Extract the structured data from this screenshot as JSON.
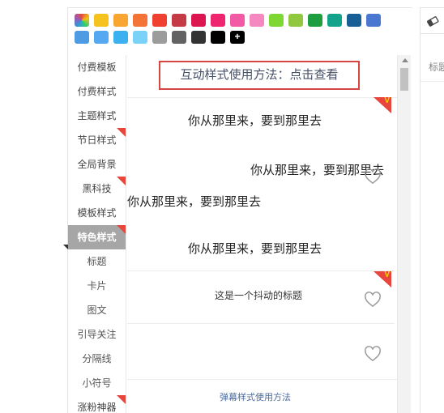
{
  "palette": {
    "row1": [
      {
        "color": "rainbow",
        "icon": "color-picker-icon"
      },
      {
        "color": "#f6c21e"
      },
      {
        "color": "#f8a532"
      },
      {
        "color": "#f37436"
      },
      {
        "color": "#f04130"
      },
      {
        "color": "#c43a45"
      },
      {
        "color": "#dc1550"
      },
      {
        "color": "#f0256f"
      },
      {
        "color": "#f35aa5"
      },
      {
        "color": "#f587c1"
      },
      {
        "color": "#7fd733"
      },
      {
        "color": "#92c840"
      },
      {
        "color": "#1e9e3f"
      },
      {
        "color": "#13a38a"
      },
      {
        "color": "#175f95"
      },
      {
        "color": "#4a77d0"
      }
    ],
    "row2": [
      {
        "color": "#4e9be3"
      },
      {
        "color": "#56a9f1"
      },
      {
        "color": "#3bb1f0"
      },
      {
        "color": "#7ad2f9"
      },
      {
        "color": "#9c9c9c"
      },
      {
        "color": "#626262"
      },
      {
        "color": "#333333"
      },
      {
        "color": "#000000"
      },
      {
        "color": "#000000",
        "label": "+",
        "icon": "add-color-icon"
      }
    ]
  },
  "sidebar": {
    "items": [
      {
        "label": "付费模板",
        "corner": false
      },
      {
        "label": "付费样式",
        "corner": false
      },
      {
        "label": "主题样式",
        "corner": false
      },
      {
        "label": "节日样式",
        "corner": true
      },
      {
        "label": "全局背景",
        "corner": false
      },
      {
        "label": "黑科技",
        "corner": true
      },
      {
        "label": "模板样式",
        "corner": false
      },
      {
        "label": "特色样式",
        "corner": true,
        "active": true
      },
      {
        "label": "标题",
        "corner": false
      },
      {
        "label": "卡片",
        "corner": false
      },
      {
        "label": "图文",
        "corner": false
      },
      {
        "label": "引导关注",
        "corner": false
      },
      {
        "label": "分隔线",
        "corner": false
      },
      {
        "label": "小符号",
        "corner": false
      },
      {
        "label": "涨粉神器",
        "corner": true
      }
    ]
  },
  "content": {
    "hint": "互动样式使用方法：点击查看",
    "demo_line": "你从那里来，要到那里去",
    "shake_title": "这是一个抖动的标题",
    "barrage_link": "弹幕样式使用方法",
    "badge_glyph": "V"
  },
  "right_panel": {
    "title_label": "标题"
  }
}
